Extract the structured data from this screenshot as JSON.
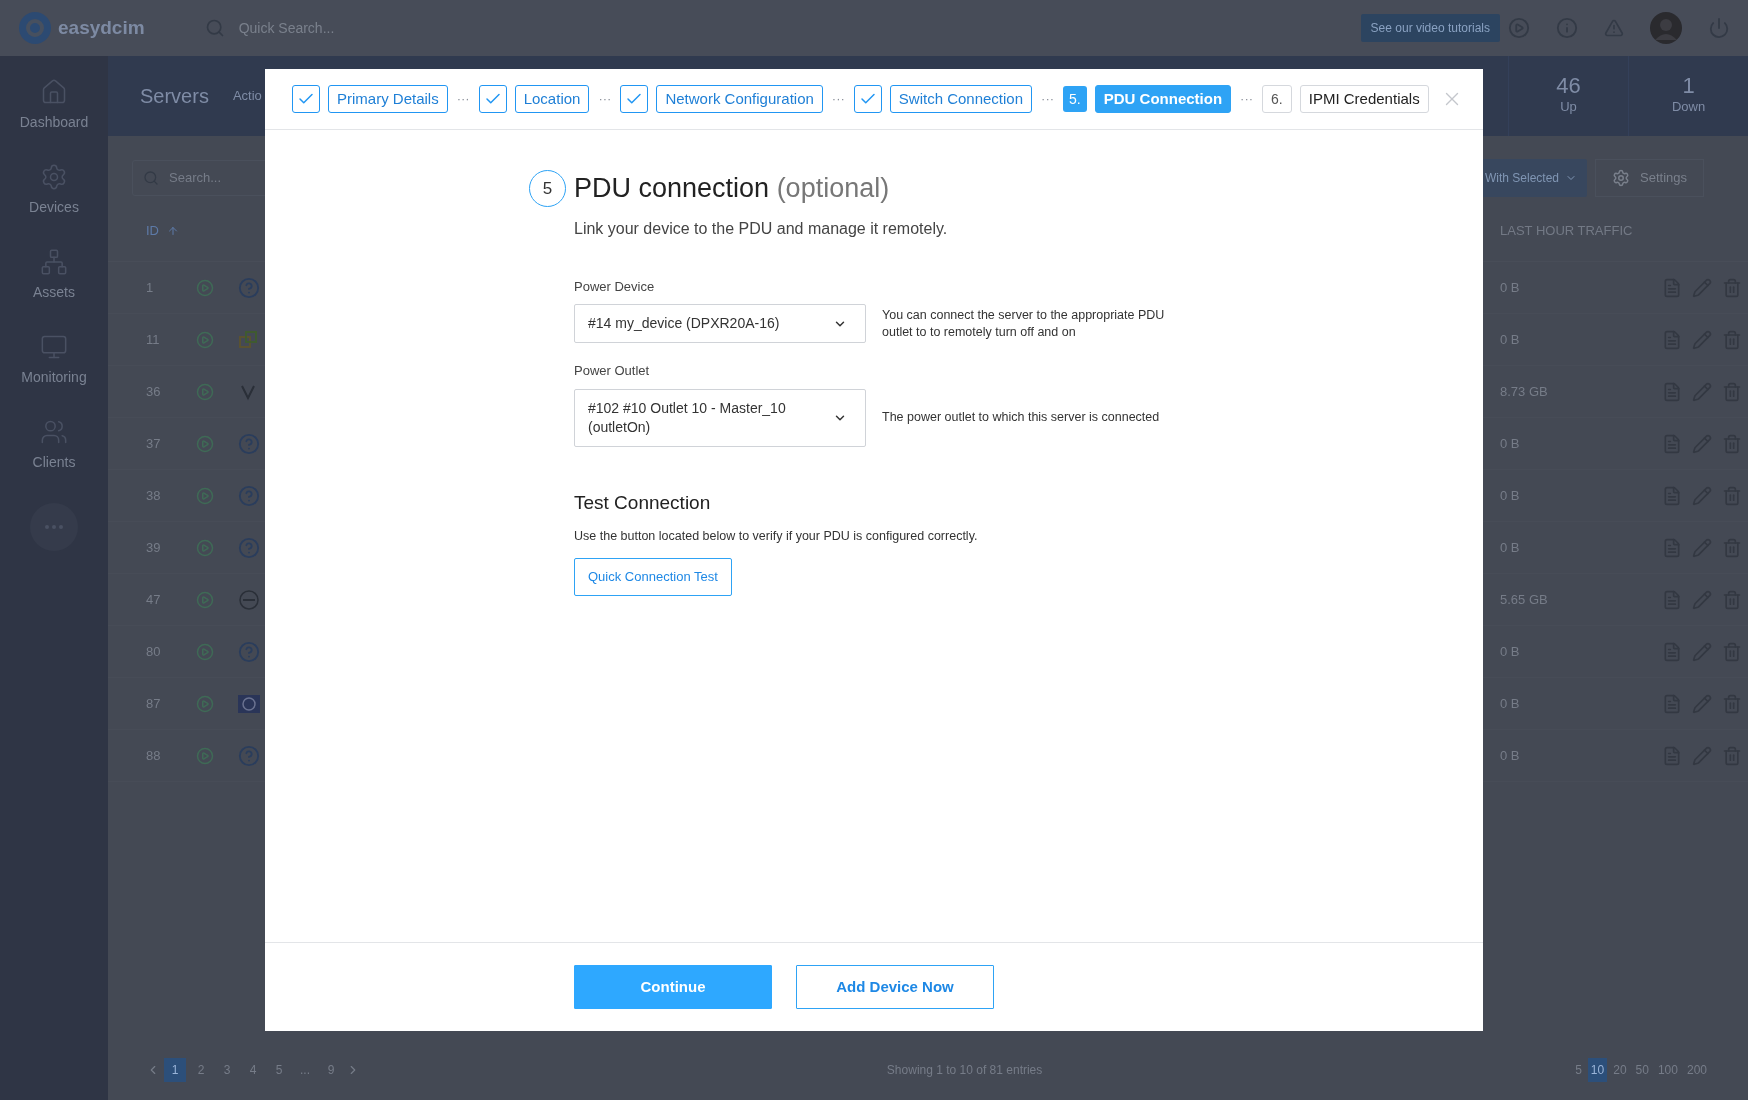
{
  "topbar": {
    "logo": "easydcim",
    "search_placeholder": "Quick Search...",
    "tutorial_button": "See our video tutorials"
  },
  "sidebar": {
    "items": [
      {
        "label": "Dashboard"
      },
      {
        "label": "Devices"
      },
      {
        "label": "Assets"
      },
      {
        "label": "Monitoring"
      },
      {
        "label": "Clients"
      }
    ]
  },
  "page": {
    "title": "Servers",
    "action_tab": "Actio",
    "stats": [
      {
        "value": "46",
        "label": "Up"
      },
      {
        "value": "1",
        "label": "Down"
      }
    ]
  },
  "toolbar": {
    "search_placeholder": "Search...",
    "with_selected": "With Selected",
    "settings": "Settings"
  },
  "table": {
    "columns": [
      "ID",
      "LAST HOUR TRAFFIC"
    ],
    "rows": [
      {
        "id": "1",
        "kind": "unknown",
        "traffic": "0 B"
      },
      {
        "id": "11",
        "kind": "boxes",
        "traffic": "0 B"
      },
      {
        "id": "36",
        "kind": "mark",
        "traffic": "8.73 GB"
      },
      {
        "id": "37",
        "kind": "unknown",
        "traffic": "0 B"
      },
      {
        "id": "38",
        "kind": "unknown",
        "traffic": "0 B"
      },
      {
        "id": "39",
        "kind": "unknown",
        "traffic": "0 B"
      },
      {
        "id": "47",
        "kind": "round",
        "traffic": "5.65 GB"
      },
      {
        "id": "80",
        "kind": "unknown",
        "traffic": "0 B"
      },
      {
        "id": "87",
        "kind": "square",
        "traffic": "0 B"
      },
      {
        "id": "88",
        "kind": "unknown",
        "traffic": "0 B"
      }
    ]
  },
  "pagination": {
    "pages": [
      {
        "label": "1",
        "selected": true
      },
      {
        "label": "2",
        "selected": false
      },
      {
        "label": "3",
        "selected": false
      },
      {
        "label": "4",
        "selected": false
      },
      {
        "label": "5",
        "selected": false
      },
      {
        "label": "...",
        "selected": false
      },
      {
        "label": "9",
        "selected": false
      }
    ],
    "info": "Showing 1 to 10 of 81 entries",
    "page_sizes": [
      {
        "label": "5",
        "selected": false
      },
      {
        "label": "10",
        "selected": true
      },
      {
        "label": "20",
        "selected": false
      },
      {
        "label": "50",
        "selected": false
      },
      {
        "label": "100",
        "selected": false
      },
      {
        "label": "200",
        "selected": false
      }
    ]
  },
  "modal": {
    "steps": [
      {
        "label": "Primary Details",
        "kind": "done"
      },
      {
        "separator_before": "···",
        "label": "Location",
        "kind": "done"
      },
      {
        "separator_before": "···",
        "label": "Network Configuration",
        "kind": "done"
      },
      {
        "separator_before": "···",
        "label": "Switch Connection",
        "kind": "done"
      },
      {
        "separator_before": "···",
        "number": "5.",
        "label": "PDU Connection",
        "kind": "current"
      },
      {
        "separator_before": "···",
        "number": "6.",
        "label": "IPMI Credentials",
        "kind": "pending"
      }
    ],
    "step_number": "5",
    "title": "PDU connection",
    "title_suffix": "(optional)",
    "subtitle": "Link your device to the PDU and manage it remotely.",
    "fields": [
      {
        "label": "Power Device",
        "value": "#14 my_device (DPXR20A-16)",
        "help": "You can connect the server to the appropriate PDU outlet to to remotely turn off and on"
      },
      {
        "label": "Power Outlet",
        "value": "#102 #10 Outlet 10 - Master_10 (outletOn)",
        "help": "The power outlet to which this server is connected"
      }
    ],
    "test": {
      "heading": "Test Connection",
      "text": "Use the button located below to verify if your PDU is configured correctly.",
      "button": "Quick Connection Test"
    },
    "footer_buttons": [
      {
        "label": "Continue",
        "kind": "primary"
      },
      {
        "label": "Add Device Now",
        "kind": "secondary"
      }
    ]
  }
}
